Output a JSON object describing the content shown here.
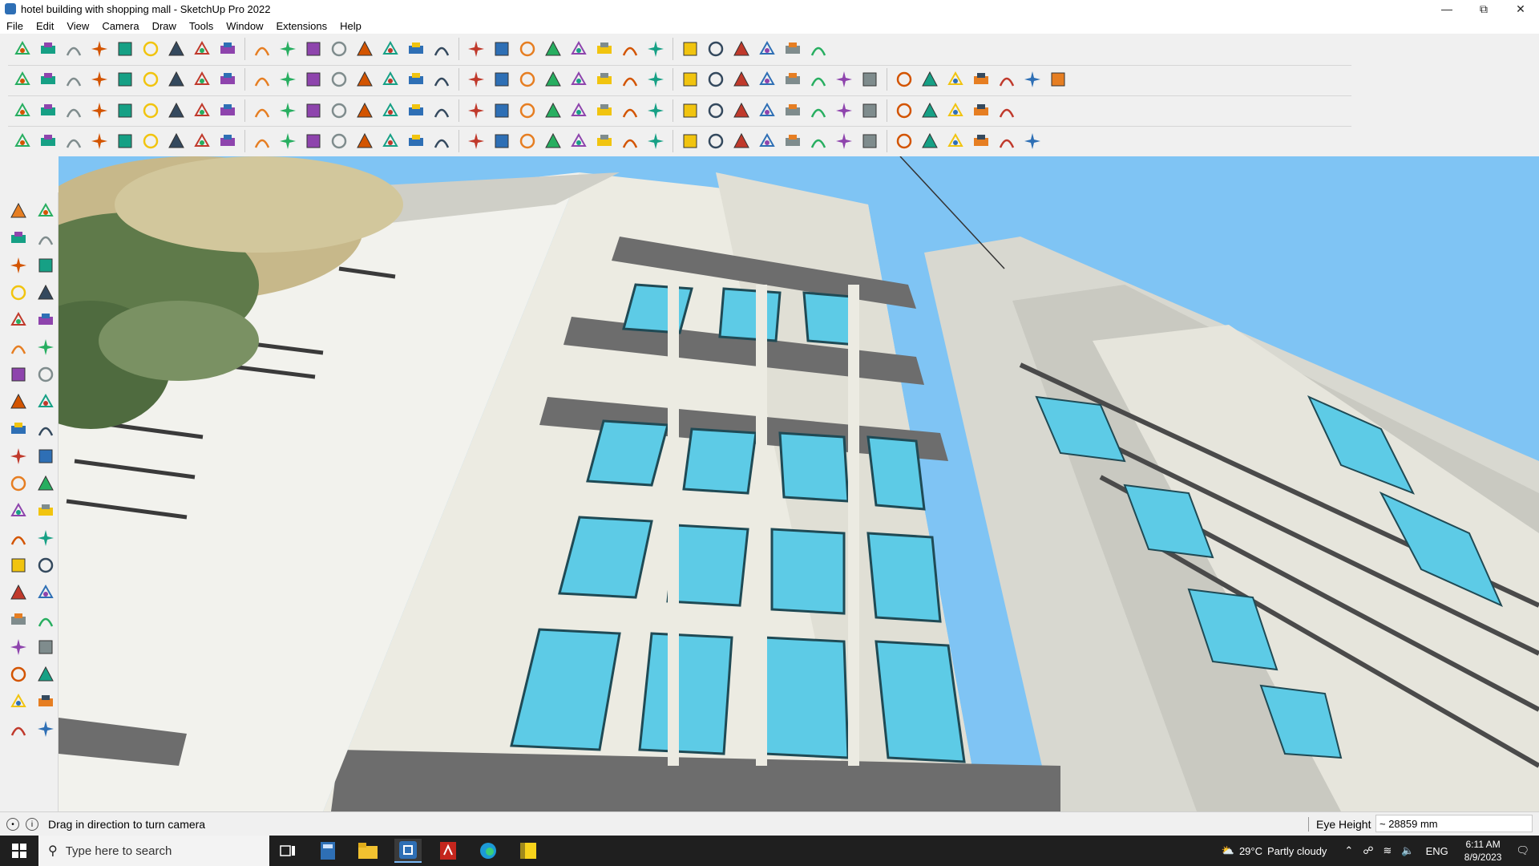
{
  "window": {
    "title": "hotel building with shopping mall - SketchUp Pro 2022",
    "controls": [
      "minimize",
      "restore",
      "close"
    ]
  },
  "menubar": {
    "items": [
      "File",
      "Edit",
      "View",
      "Camera",
      "Draw",
      "Tools",
      "Window",
      "Extensions",
      "Help"
    ]
  },
  "toolbars": {
    "row1": [
      "zoom-window",
      "select",
      "eraser",
      "pencil-line",
      "arc",
      "rectangle",
      "push-pull",
      "follow-me",
      "move",
      "rotate",
      "scale",
      "tape-measure",
      "text",
      "paint-bucket",
      "orbit",
      "pan",
      "zoom",
      "zoom-extents",
      "iso-view",
      "top-view",
      "front-view",
      "layers",
      "account",
      "styles",
      "components",
      "axes",
      "sandbox",
      "section-plane",
      "undo",
      "redo",
      "solid-tools"
    ],
    "row2": [
      "warehouse",
      "extension-warehouse",
      "layout",
      "push",
      "outer-shell",
      "intersect",
      "union",
      "subtract",
      "trim",
      "split",
      "soften",
      "hidden-geometry",
      "section-display",
      "house-1",
      "house-2",
      "house-3",
      "house-4",
      "house-5",
      "dimension",
      "protractor",
      "pencil-2",
      "round-corners",
      "shape-1",
      "shape-2",
      "shape-3",
      "shape-4",
      "shape-5",
      "shape-6",
      "shape-7",
      "shape-8",
      "shape-9",
      "line-red",
      "eraser-pink",
      "material-1",
      "material-2",
      "material-3",
      "material-4",
      "material-5",
      "material-6",
      "material-7"
    ],
    "row3": [
      "face-blue",
      "face-blue-2",
      "face-yellow",
      "face-green",
      "face-red",
      "face-gray",
      "loop-orange",
      "square-red",
      "grid",
      "panel",
      "beam",
      "chain",
      "dots",
      "bezier",
      "plus-red",
      "plus-green",
      "cross-blue",
      "cone",
      "flame",
      "warning",
      "ring",
      "pretzel",
      "spiral",
      "snap",
      "box-brown",
      "magnet",
      "tree",
      "swap",
      "duplicate",
      "gem-red",
      "gift",
      "frame",
      "window-orange",
      "grid-orange",
      "grid-orange-2",
      "explode",
      "arc-dotted",
      "array"
    ],
    "row4": [
      "shape-outline",
      "curve-red",
      "car",
      "scissors",
      "gear",
      "cloud",
      "hose",
      "cylinder",
      "globe",
      "swirl",
      "corner",
      "corner-2",
      "ruler",
      "spoon",
      "column",
      "pyramid",
      "grass",
      "brain",
      "hand",
      "leaf",
      "arrows",
      "stairs",
      "ramp",
      "slope-1",
      "slope-2",
      "slope-3",
      "slope-4",
      "slope-5",
      "stair-2",
      "stair-3",
      "stair-4",
      "stair-5",
      "stair-6",
      "stair-7",
      "stair-8",
      "stair-9",
      "stair-10",
      "stair-11",
      "stair-12"
    ]
  },
  "left_toolbar": [
    "select-arrow",
    "make-component",
    "paint-bucket",
    "eraser",
    "tags",
    "tape",
    "line",
    "freehand",
    "rectangle",
    "rotated-rectangle",
    "circle",
    "polygon",
    "arc",
    "pie",
    "move",
    "push-pull",
    "rotate",
    "follow-me",
    "scale",
    "offset",
    "tape-measure",
    "dimension",
    "protractor",
    "text",
    "axes",
    "3d-text",
    "orbit",
    "pan",
    "zoom",
    "zoom-window",
    "zoom-extents",
    "previous",
    "position-camera",
    "look-around",
    "walk",
    "section-plane",
    "warehouse",
    "extension-warehouse",
    "layout",
    "send-to-layout"
  ],
  "status": {
    "hint": "Drag in direction to turn camera",
    "measure_label": "Eye Height",
    "measure_value": "~ 28859 mm"
  },
  "taskbar": {
    "search_placeholder": "Type here to search",
    "weather_temp": "29°C",
    "weather_text": "Partly cloudy",
    "lang": "ENG",
    "time": "6:11 AM",
    "date": "8/9/2023"
  },
  "colors": {
    "sky": "#7fc4f4",
    "facade_light": "#ecebe2",
    "facade_dark": "#6d6d6d",
    "glass": "#5dcbe6",
    "tree_green": "#5f7a4a",
    "tree_tan": "#c7b88a"
  }
}
